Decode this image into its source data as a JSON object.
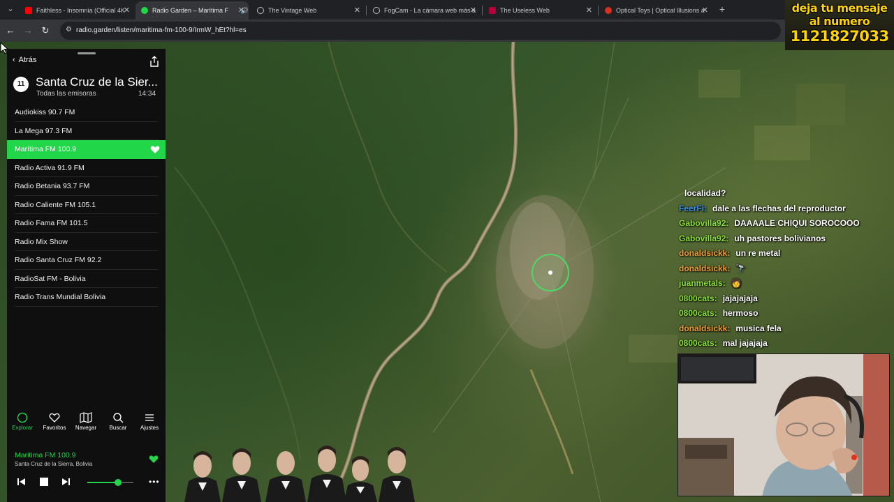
{
  "browser": {
    "tabs": [
      {
        "title": "Faithless - Insomnia (Official 4K",
        "color": "#ff0000",
        "active": false
      },
      {
        "title": "Radio Garden – Marítima F",
        "color": "#22d64a",
        "active": true,
        "audio": true
      },
      {
        "title": "The Vintage Web",
        "color": "#bdc1c6",
        "active": false
      },
      {
        "title": "FogCam - La cámara web más a",
        "color": "#bdc1c6",
        "active": false
      },
      {
        "title": "The Useless Web",
        "color": "#b3003b",
        "active": false
      },
      {
        "title": "Optical Toys | Optical Illusions a",
        "color": "#d93025",
        "active": false
      }
    ],
    "url": "radio.garden/listen/maritima-fm-100-9/IrmW_hEt?hl=es"
  },
  "banner": {
    "line1": "deja tu mensaje",
    "line2": "al numero",
    "line3": "1121827033"
  },
  "panel": {
    "back_label": "Atrás",
    "station_count": "11",
    "city": "Santa Cruz de la Sier...",
    "subtitle": "Todas las emisoras",
    "local_time": "14:34",
    "stations": [
      {
        "name": "Audiokiss 90.7 FM",
        "active": false
      },
      {
        "name": "La Mega 97.3 FM",
        "active": false
      },
      {
        "name": "Marítima FM 100.9",
        "active": true
      },
      {
        "name": "Radio Activa 91.9 FM",
        "active": false
      },
      {
        "name": "Radio Betania 93.7 FM",
        "active": false
      },
      {
        "name": "Radio Caliente FM 105.1",
        "active": false
      },
      {
        "name": "Radio Fama FM 101.5",
        "active": false
      },
      {
        "name": "Radio Mix Show",
        "active": false
      },
      {
        "name": "Radio Santa Cruz FM 92.2",
        "active": false
      },
      {
        "name": "RadioSat FM - Bolivia",
        "active": false
      },
      {
        "name": "Radio Trans Mundial Bolivia",
        "active": false
      }
    ],
    "nav": [
      {
        "label": "Explorar",
        "icon": "explore-icon",
        "active": true
      },
      {
        "label": "Favoritos",
        "icon": "heart-icon",
        "active": false
      },
      {
        "label": "Navegar",
        "icon": "map-icon",
        "active": false
      },
      {
        "label": "Buscar",
        "icon": "search-icon",
        "active": false
      },
      {
        "label": "Ajustes",
        "icon": "menu-icon",
        "active": false
      }
    ],
    "player": {
      "title": "Maritima FM 100.9",
      "location": "Santa Cruz de la Sierra, Bolivia",
      "volume": 0.66
    },
    "accent_color": "#22d64a"
  },
  "chat": [
    {
      "user": "",
      "message": "localidad?",
      "color": "#ffffff"
    },
    {
      "user": "FeerFi:",
      "message": "dale a las flechas del reproductor",
      "color": "#3a8ee6"
    },
    {
      "user": "Gabovilla92:",
      "message": "DAAAALE CHIQUI SOROCOOO",
      "color": "#8ae234"
    },
    {
      "user": "Gabovilla92:",
      "message": "uh pastores bolivianos",
      "color": "#8ae234"
    },
    {
      "user": "donaldsickk:",
      "message": "un re metal",
      "color": "#f0a030"
    },
    {
      "user": "donaldsickk:",
      "message": "🔭",
      "color": "#f0a030"
    },
    {
      "user": "juanmetals:",
      "message": "🧑",
      "color": "#8ae234"
    },
    {
      "user": "0800cats:",
      "message": "jajajajaja",
      "color": "#8ae234"
    },
    {
      "user": "0800cats:",
      "message": "hermoso",
      "color": "#8ae234"
    },
    {
      "user": "donaldsickk:",
      "message": "musica fela",
      "color": "#f0a030"
    },
    {
      "user": "0800cats:",
      "message": "mal jajajaja",
      "color": "#8ae234"
    }
  ]
}
